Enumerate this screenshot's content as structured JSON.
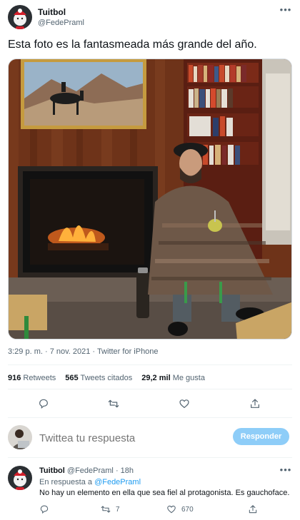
{
  "tweet": {
    "author_name": "Tuitbol",
    "author_handle": "@FedePraml",
    "text": "Esta foto es la fantasmeada más grande del año.",
    "timestamp": "3:29 p. m. · 7 nov. 2021 · Twitter for iPhone",
    "stats": {
      "retweets_count": "916",
      "retweets_label": "Retweets",
      "quotes_count": "565",
      "quotes_label": "Tweets citados",
      "likes_count": "29,2 mil",
      "likes_label": "Me gusta"
    }
  },
  "composer": {
    "placeholder": "Twittea tu respuesta",
    "button_label": "Responder"
  },
  "reply": {
    "author_name": "Tuitbol",
    "author_handle": "@FedePraml",
    "separator": "·",
    "time": "18h",
    "reply_prefix": "En respuesta a",
    "reply_mention": "@FedePraml",
    "text": "No hay un elemento en ella que sea fiel al protagonista. Es gauchoface.",
    "retweets": "7",
    "likes": "670"
  },
  "icons": {
    "more": "more-icon",
    "reply": "reply-icon",
    "retweet": "retweet-icon",
    "like": "heart-icon",
    "share": "share-icon"
  },
  "colors": {
    "accent": "#1d9bf0",
    "button_disabled": "#8ecdf8",
    "muted_text": "#536471"
  }
}
